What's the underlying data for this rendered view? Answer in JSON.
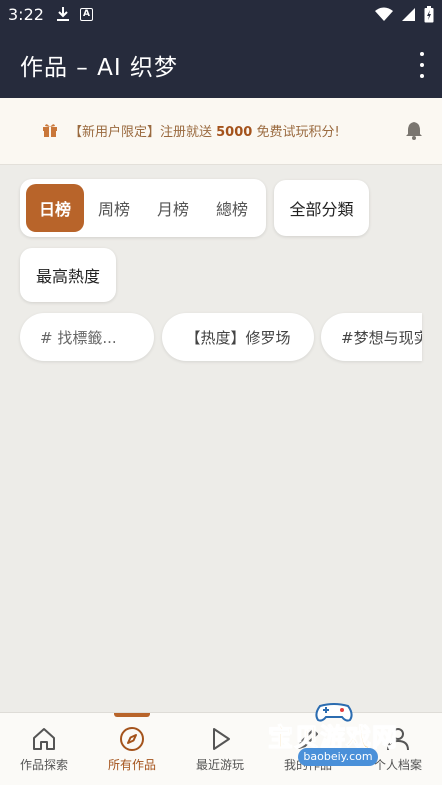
{
  "status": {
    "time": "3:22"
  },
  "appbar": {
    "title": "作品 – AI 织梦",
    "menu_icon": "more-vert-icon"
  },
  "promo": {
    "prefix": "【新用户限定】注册就送 ",
    "amount": "5000",
    "suffix": " 免费试玩积分!",
    "gift_icon": "gift-icon",
    "bell_icon": "bell-icon"
  },
  "filters": {
    "period_tabs": [
      {
        "label": "日榜",
        "active": true
      },
      {
        "label": "周榜",
        "active": false
      },
      {
        "label": "月榜",
        "active": false
      },
      {
        "label": "總榜",
        "active": false
      }
    ],
    "category_button": "全部分類",
    "sort_button": "最高熱度",
    "tag_search_placeholder": "# 找標籤...",
    "tag_chips": [
      "【热度】修罗场",
      "#梦想与现实"
    ]
  },
  "nav": {
    "items": [
      {
        "label": "作品探索",
        "icon": "home-icon"
      },
      {
        "label": "所有作品",
        "icon": "compass-icon",
        "active": true
      },
      {
        "label": "最近游玩",
        "icon": "play-icon"
      },
      {
        "label": "我的作品",
        "icon": "pen-icon"
      },
      {
        "label": "个人档案",
        "icon": "person-icon"
      }
    ]
  },
  "watermark": {
    "title": "宝贝游戏网",
    "url": "baobeiy.com"
  },
  "colors": {
    "accent": "#b8642a",
    "appbar": "#262b3c",
    "background": "#edece8"
  }
}
